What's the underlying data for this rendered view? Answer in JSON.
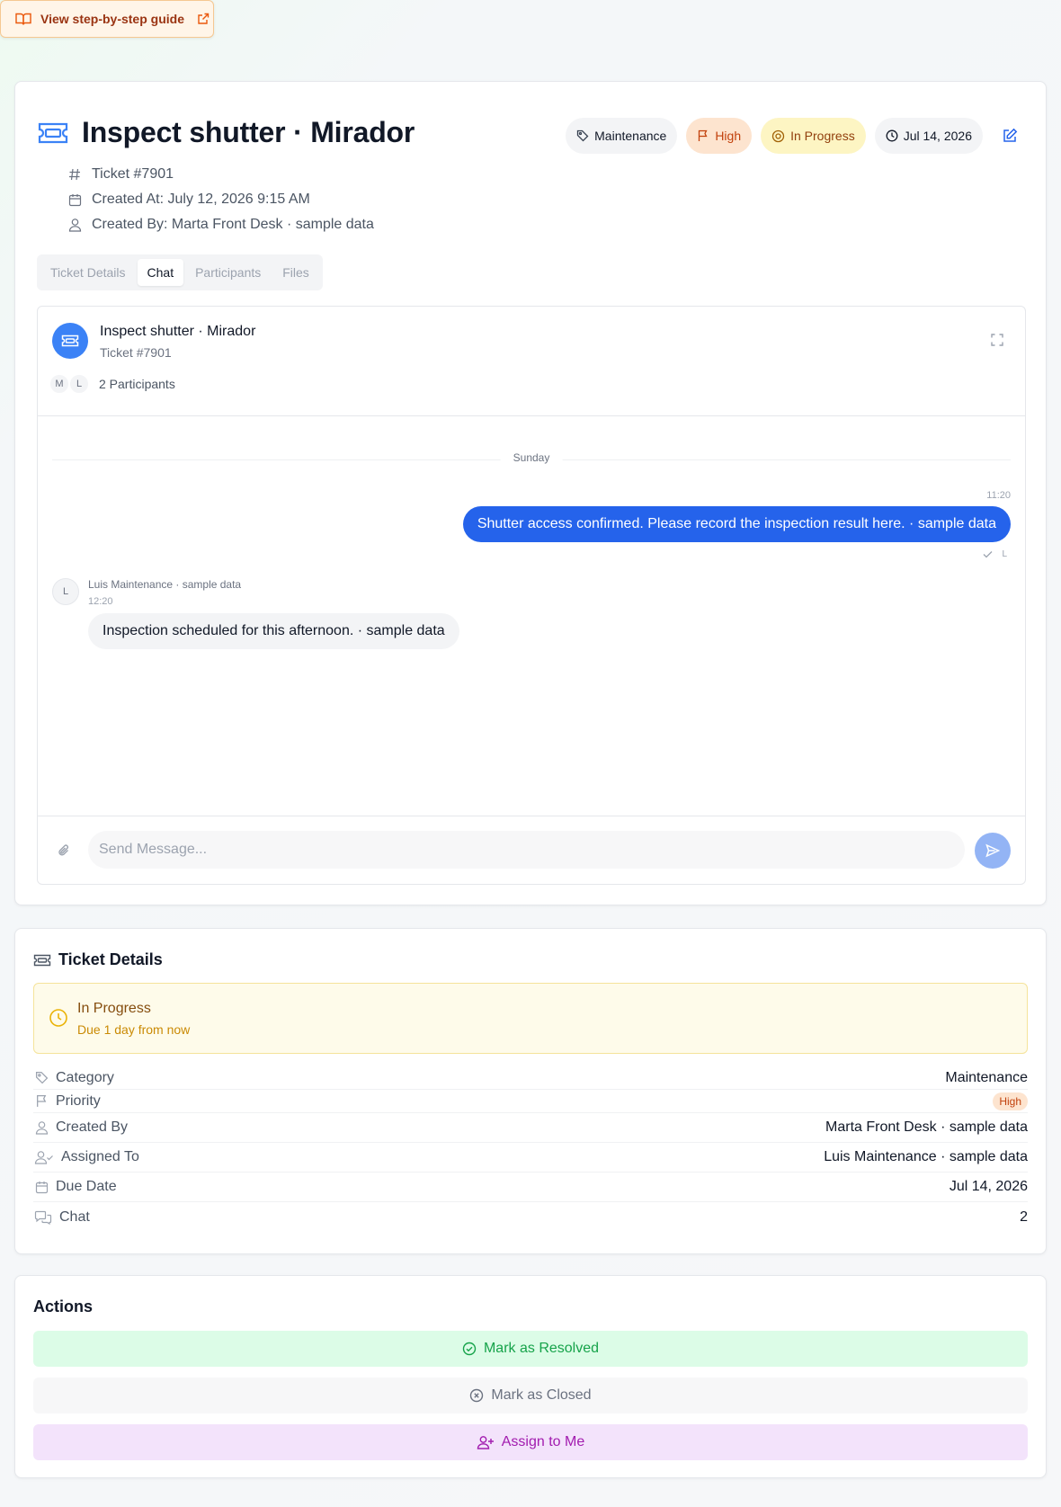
{
  "guide": {
    "label": "View step-by-step guide"
  },
  "ticket": {
    "title": "Inspect shutter · Mirador",
    "number": "Ticket #7901",
    "created_at": "Created At: July 12, 2026 9:15 AM",
    "created_by": "Created By: Marta Front Desk · sample data"
  },
  "badges": {
    "category": "Maintenance",
    "priority": "High",
    "status": "In Progress",
    "due": "Jul 14, 2026"
  },
  "tabs": [
    {
      "label": "Ticket Details"
    },
    {
      "label": "Chat"
    },
    {
      "label": "Participants"
    },
    {
      "label": "Files"
    }
  ],
  "chat": {
    "title": "Inspect shutter · Mirador",
    "subtitle": "Ticket #7901",
    "participants": [
      "M",
      "L"
    ],
    "participants_label": "2 Participants",
    "day": "Sunday",
    "messages": [
      {
        "time": "11:20",
        "text": "Shutter access confirmed. Please record the inspection result here. · sample data",
        "read_by": "L"
      },
      {
        "sender": "Luis Maintenance · sample data",
        "initial": "L",
        "time": "12:20",
        "text": "Inspection scheduled for this afternoon. · sample data"
      }
    ],
    "input_placeholder": "Send Message..."
  },
  "details": {
    "title": "Ticket Details",
    "status": "In Progress",
    "status_sub": "Due 1 day from now",
    "rows": [
      {
        "label": "Category",
        "value": "Maintenance"
      },
      {
        "label": "Priority",
        "value": "High"
      },
      {
        "label": "Created By",
        "value": "Marta Front Desk · sample data"
      },
      {
        "label": "Assigned To",
        "value": "Luis Maintenance · sample data"
      },
      {
        "label": "Due Date",
        "value": "Jul 14, 2026"
      },
      {
        "label": "Chat",
        "value": "2"
      }
    ]
  },
  "actions": {
    "title": "Actions",
    "resolve": "Mark as Resolved",
    "close": "Mark as Closed",
    "assign": "Assign to Me"
  },
  "colors": {
    "accent_blue": "#2563eb",
    "resolve_green": "#16a34a",
    "assign_purple": "#a21caf",
    "priority_orange": "#c2410c",
    "status_yellow": "#ca8a04"
  },
  "icons": {
    "guide": "book-open-icon",
    "guide_external": "external-link-icon",
    "ticket": "ticket-icon",
    "category": "tag-icon",
    "priority": "flag-icon",
    "status": "circle-dot-icon",
    "due": "clock-icon",
    "edit": "edit-icon",
    "hash": "hash-icon",
    "calendar": "calendar-icon",
    "user": "user-icon",
    "user_check": "user-check-icon",
    "chat": "messages-icon",
    "attach": "paperclip-icon",
    "send": "send-icon",
    "expand": "expand-icon",
    "resolve": "check-circle-icon",
    "close": "x-circle-icon",
    "assign": "user-plus-icon"
  }
}
